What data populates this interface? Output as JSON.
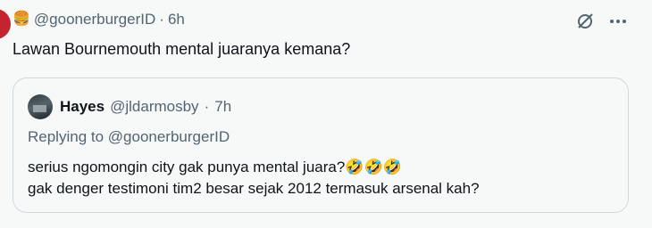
{
  "tweet": {
    "author_emoji": "🍔",
    "handle": "@goonerburgerID",
    "separator": "·",
    "time": "6h",
    "text": "Lawan Bournemouth mental juaranya kemana?",
    "more_label": "···"
  },
  "quote": {
    "name": "Hayes",
    "handle": "@jldarmosby",
    "separator": "·",
    "time": "7h",
    "replying_to": "Replying to @goonerburgerID",
    "line1": "serius ngomongin city gak punya mental juara?🤣🤣🤣",
    "line2": "gak denger testimoni tim2 besar sejak 2012 termasuk arsenal kah?"
  },
  "icons": {
    "grok": "grok-icon",
    "more": "more-icon"
  },
  "colors": {
    "background": "#f7f9f9",
    "text_primary": "#0f1419",
    "text_secondary": "#536471",
    "border": "#cfd9de"
  }
}
